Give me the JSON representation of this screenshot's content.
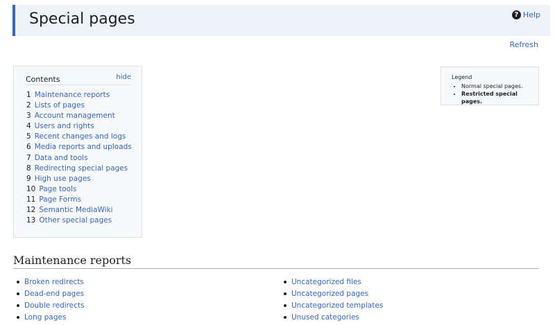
{
  "header": {
    "title": "Special pages",
    "help_label": "Help"
  },
  "refresh_label": "Refresh",
  "toc": {
    "title": "Contents",
    "hide_label": "hide",
    "items": [
      {
        "num": "1",
        "label": "Maintenance reports"
      },
      {
        "num": "2",
        "label": "Lists of pages"
      },
      {
        "num": "3",
        "label": "Account management"
      },
      {
        "num": "4",
        "label": "Users and rights"
      },
      {
        "num": "5",
        "label": "Recent changes and logs"
      },
      {
        "num": "6",
        "label": "Media reports and uploads"
      },
      {
        "num": "7",
        "label": "Data and tools"
      },
      {
        "num": "8",
        "label": "Redirecting special pages"
      },
      {
        "num": "9",
        "label": "High use pages"
      },
      {
        "num": "10",
        "label": "Page tools"
      },
      {
        "num": "11",
        "label": "Page Forms"
      },
      {
        "num": "12",
        "label": "Semantic MediaWiki"
      },
      {
        "num": "13",
        "label": "Other special pages"
      }
    ]
  },
  "legend": {
    "title": "Legend",
    "normal": "Normal special pages.",
    "restricted": "Restricted special pages."
  },
  "maintenance": {
    "heading": "Maintenance reports",
    "left": [
      "Broken redirects",
      "Dead-end pages",
      "Double redirects",
      "Long pages"
    ],
    "right": [
      "Uncategorized files",
      "Uncategorized pages",
      "Uncategorized templates",
      "Unused categories"
    ]
  },
  "colors": {
    "link": "#3366cc",
    "accent": "#3366cc",
    "header_bg": "#eef2f9"
  }
}
